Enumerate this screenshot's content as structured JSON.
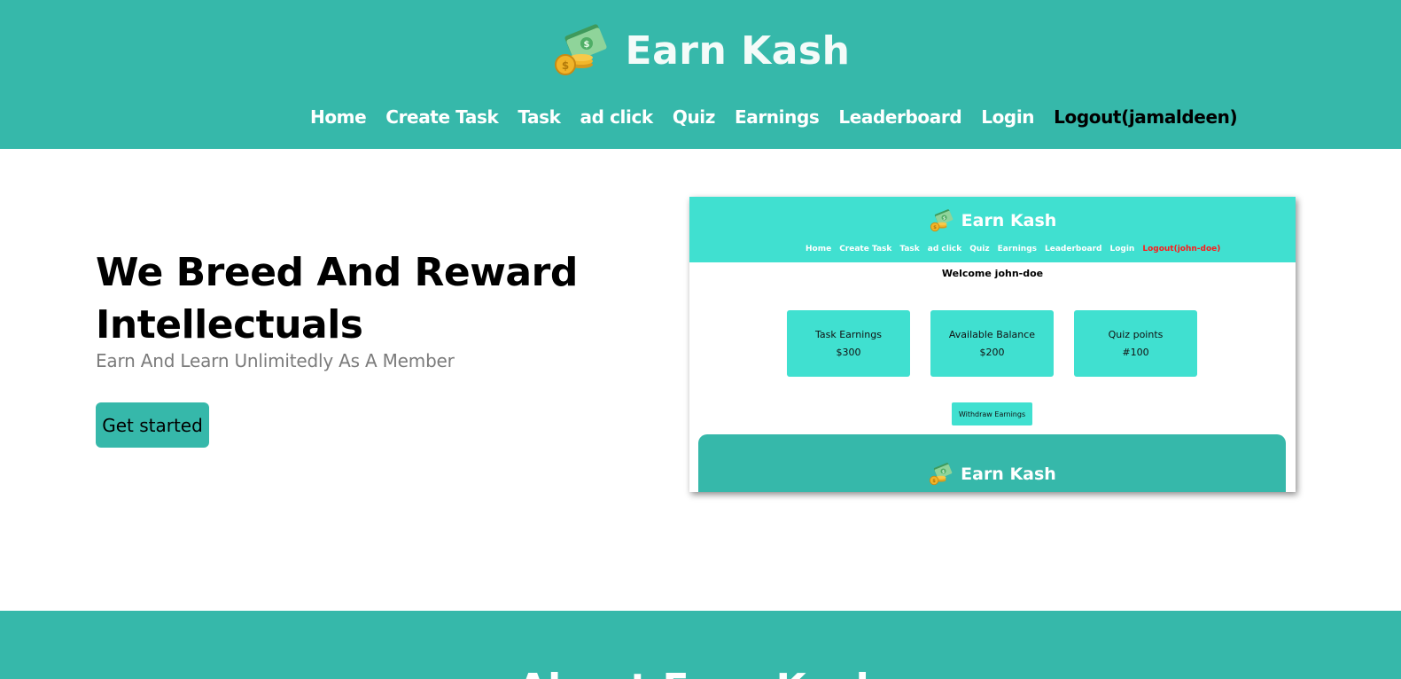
{
  "brand": {
    "name": "Earn Kash",
    "icon": "money-cash-icon"
  },
  "nav": {
    "items": [
      {
        "label": "Home"
      },
      {
        "label": "Create Task"
      },
      {
        "label": "Task"
      },
      {
        "label": "ad click"
      },
      {
        "label": "Quiz"
      },
      {
        "label": "Earnings"
      },
      {
        "label": "Leaderboard"
      },
      {
        "label": "Login"
      },
      {
        "label": "Logout(jamaldeen)"
      }
    ]
  },
  "hero": {
    "title": "We Breed And Reward Intellectuals",
    "subtitle": "Earn And Learn Unlimitedly As A Member",
    "cta_label": "Get started"
  },
  "preview": {
    "brand_name": "Earn Kash",
    "nav": [
      "Home",
      "Create Task",
      "Task",
      "ad click",
      "Quiz",
      "Earnings",
      "Leaderboard",
      "Login",
      "Logout(john-doe)"
    ],
    "welcome": "Welcome john-doe",
    "cards": [
      {
        "label": "Task Earnings",
        "value": "$300"
      },
      {
        "label": "Available Balance",
        "value": "$200"
      },
      {
        "label": "Quiz points",
        "value": "#100"
      }
    ],
    "withdraw_label": "Withdraw Earnings",
    "footer_brand_name": "Earn Kash"
  },
  "about": {
    "title": "About Earn Kash"
  },
  "colors": {
    "primary": "#36b8aa",
    "preview_primary": "#40e0d0",
    "active_link_preview": "#ff1a1a",
    "muted_text": "#7b7b7b"
  }
}
